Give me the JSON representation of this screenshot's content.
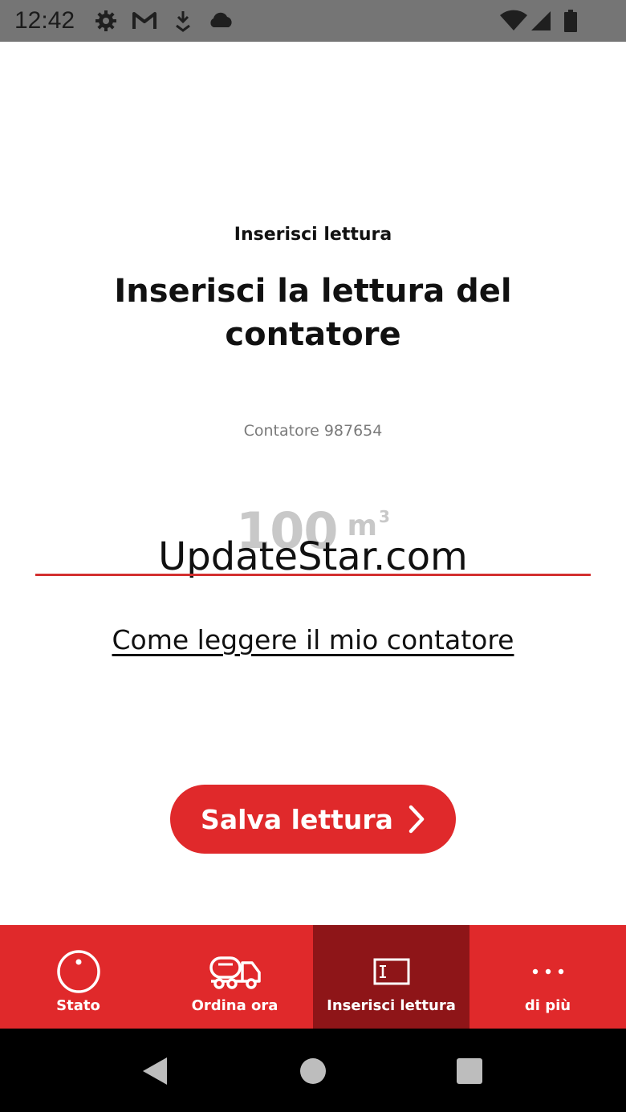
{
  "status_bar": {
    "time": "12:42",
    "icons_left": [
      "gear-icon",
      "gmail-icon",
      "download-icon",
      "cloud-icon"
    ],
    "icons_right": [
      "wifi-icon",
      "signal-icon",
      "battery-icon"
    ]
  },
  "page": {
    "eyebrow": "Inserisci lettura",
    "headline": "Inserisci la lettura del contatore",
    "meter_label": "Contatore 987654",
    "reading_placeholder": "100",
    "reading_unit": "m",
    "reading_unit_exp": "3",
    "watermark": "UpdateStar.com",
    "help_link": "Come leggere il mio contatore",
    "save_button": "Salva lettura"
  },
  "bottom_nav": {
    "active_index": 2,
    "items": [
      {
        "label": "Stato",
        "icon": "gauge-icon"
      },
      {
        "label": "Ordina ora",
        "icon": "tanker-truck-icon"
      },
      {
        "label": "Inserisci lettura",
        "icon": "meter-display-icon"
      },
      {
        "label": "di più",
        "icon": "more-dots-icon"
      }
    ]
  },
  "colors": {
    "brand_red": "#e0292b",
    "active_tab": "#8e1518",
    "input_line": "#d32f2f",
    "status_bar": "#757575"
  }
}
